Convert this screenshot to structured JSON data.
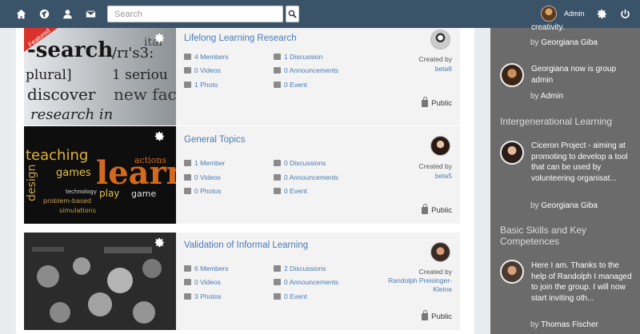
{
  "search": {
    "placeholder": "Search"
  },
  "user": {
    "name": "Admin"
  },
  "groups": [
    {
      "title": "Lifelong Learning Research",
      "featured_label": "Featured",
      "members": "4 Members",
      "discussions": "1 Discussion",
      "videos": "0 Videos",
      "announcements": "0 Announcements",
      "photos": "1 Photo",
      "events": "0 Event",
      "created_by_label": "Created by",
      "creator": "beta6",
      "privacy": "Public",
      "thumb_words": [
        "-search",
        "/rɪ's3:",
        "plural]",
        "1 seriou",
        "discover",
        "new fac",
        "research in",
        "ital"
      ]
    },
    {
      "title": "General Topics",
      "members": "1 Member",
      "discussions": "0 Discussions",
      "videos": "0 Videos",
      "announcements": "0 Announcements",
      "photos": "0 Photos",
      "events": "0 Event",
      "created_by_label": "Created by",
      "creator": "beta5",
      "privacy": "Public",
      "thumb_words": [
        "teaching",
        "learni",
        "games",
        "design",
        "play",
        "game",
        "technology",
        "actions",
        "problem-based",
        "simulations"
      ]
    },
    {
      "title": "Validation of Informal Learning",
      "members": "6 Members",
      "discussions": "2 Discussions",
      "videos": "0 Videos",
      "announcements": "0 Announcements",
      "photos": "3 Photos",
      "events": "0 Event",
      "created_by_label": "Created by",
      "creator": "Randolph Preisinger-Kleine",
      "privacy": "Public"
    }
  ],
  "sidebar": {
    "top_partial": {
      "text_tail": "creativity.",
      "by_label": "by",
      "author": "Georgiana Giba"
    },
    "activity1": {
      "text": "Georgiana now is group admin",
      "by_label": "by",
      "author": "Admin"
    },
    "section1": "Intergenerational Learning",
    "activity2": {
      "text": "Ciceron Project - aiming at promoting to develop a tool that can be used by volunteering organisat...",
      "by_label": "by",
      "author": "Georgiana Giba"
    },
    "section2": "Basic Skills and Key Competences",
    "activity3": {
      "text": "Here I am. Thanks to the help of Randolph I managed to join the group. I will now start inviting oth...",
      "by_label": "by",
      "author": "Thomas Fischer"
    }
  },
  "colors": {
    "topbar": "#3b5369",
    "link": "#4a7bb5",
    "sidebar": "#6b6b6b",
    "featured": "#d9322b"
  },
  "icons": [
    "home-icon",
    "globe-icon",
    "user-icon",
    "mail-icon",
    "search-icon",
    "gear-icon",
    "power-icon",
    "members-icon",
    "discussion-icon",
    "video-icon",
    "announcement-icon",
    "photo-icon",
    "event-icon",
    "lock-icon"
  ]
}
